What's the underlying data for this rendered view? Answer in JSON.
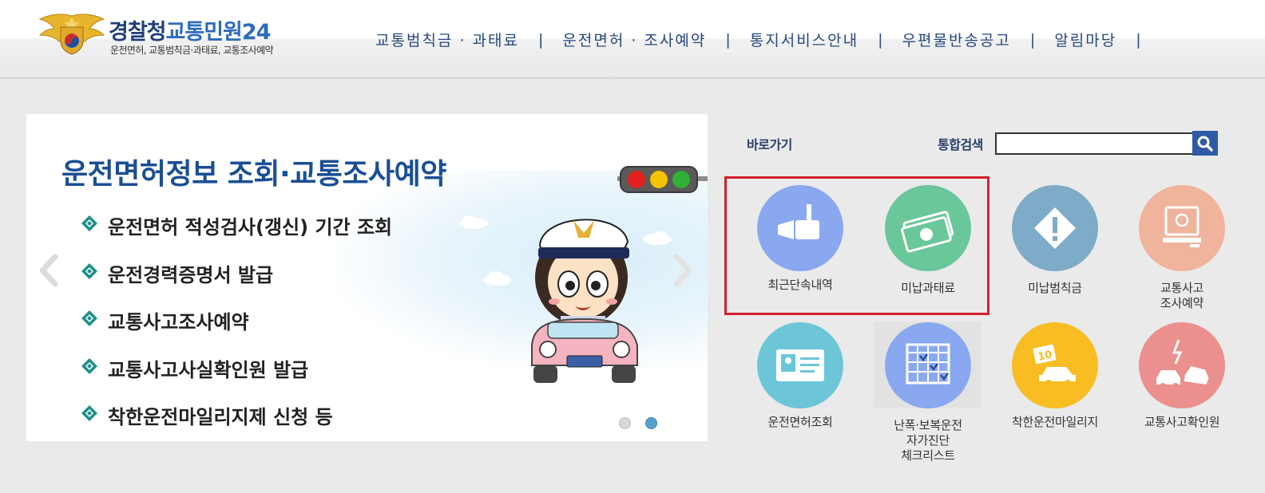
{
  "header": {
    "logo_title_main": "경찰청",
    "logo_title_sub": "교통민원24",
    "logo_subtitle": "운전면허, 교통범칙금·과태료, 교통조사예약",
    "nav": [
      {
        "label": "교통범칙금 · 과태료"
      },
      {
        "label": "운전면허 · 조사예약"
      },
      {
        "label": "통지서비스안내"
      },
      {
        "label": "우편물반송공고"
      },
      {
        "label": "알림마당"
      }
    ],
    "separator": "|"
  },
  "banner": {
    "title": "운전면허정보 조회·교통조사예약",
    "items": [
      {
        "label": "운전면허 적성검사(갱신) 기간 조회"
      },
      {
        "label": "운전경력증명서 발급"
      },
      {
        "label": "교통사고조사예약"
      },
      {
        "label": "교통사고사실확인원 발급"
      },
      {
        "label": "착한운전마일리지제 신청 등"
      }
    ],
    "active_slide": 2,
    "slide_count": 2,
    "accent_color": "#1a4f94",
    "bullet_color": "#1e8f8a"
  },
  "quick": {
    "label": "바로가기",
    "search_label": "통합검색",
    "search_value": "",
    "items": [
      {
        "label": "최근단속내역",
        "icon": "camera-icon",
        "color": "#8aa8f0"
      },
      {
        "label": "미납과태료",
        "icon": "money-icon",
        "color": "#69c79a"
      },
      {
        "label": "미납범칙금",
        "icon": "warning-icon",
        "color": "#7eabc8"
      },
      {
        "label": "교통사고 조사예약",
        "line1": "교통사고",
        "line2": "조사예약",
        "icon": "computer-icon",
        "color": "#f0b39c"
      },
      {
        "label": "운전면허조회",
        "icon": "id-card-icon",
        "color": "#6cc6d8"
      },
      {
        "label": "난폭·보복운전 자가진단 체크리스트",
        "line1": "난폭·보복운전",
        "line2": "자가진단",
        "line3": "체크리스트",
        "icon": "calendar-check-icon",
        "color": "#8aa8f0"
      },
      {
        "label": "착한운전마일리지",
        "icon": "car-mileage-icon",
        "color": "#f8bd23"
      },
      {
        "label": "교통사고확인원",
        "icon": "car-crash-icon",
        "color": "#ec8f8f"
      }
    ],
    "highlight_color": "#d3202d"
  }
}
